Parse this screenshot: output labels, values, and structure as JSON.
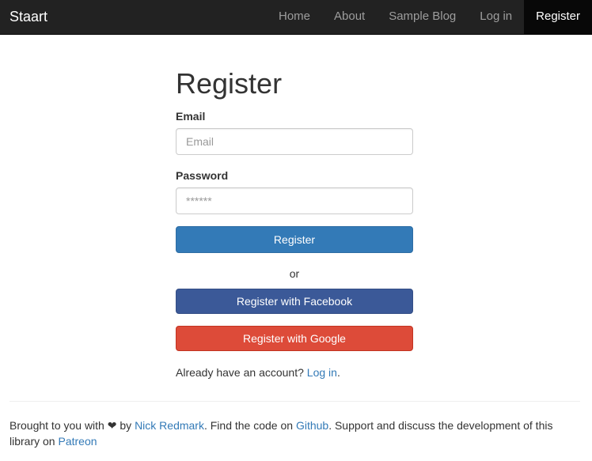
{
  "navbar": {
    "brand": "Staart",
    "items": [
      {
        "label": "Home"
      },
      {
        "label": "About"
      },
      {
        "label": "Sample Blog"
      },
      {
        "label": "Log in"
      },
      {
        "label": "Register",
        "active": true
      }
    ]
  },
  "form": {
    "title": "Register",
    "email_label": "Email",
    "email_placeholder": "Email",
    "password_label": "Password",
    "password_placeholder": "******",
    "submit_label": "Register",
    "or_text": "or",
    "facebook_label": "Register with Facebook",
    "google_label": "Register with Google",
    "already_text": "Already have an account?",
    "login_link": "Log in",
    "period": "."
  },
  "footer": {
    "t1": "Brought to you with",
    "heart": "❤",
    "t2": "by",
    "author_link": "Nick Redmark",
    "t3": ". Find the code on",
    "github_link": "Github",
    "t4": ". Support and discuss the development of this library on",
    "patreon_link": "Patreon"
  },
  "colors": {
    "navbar_bg": "#222222",
    "active_bg": "#080808",
    "primary": "#337ab7",
    "facebook": "#3b5998",
    "google": "#dd4b39",
    "link": "#337ab7"
  }
}
